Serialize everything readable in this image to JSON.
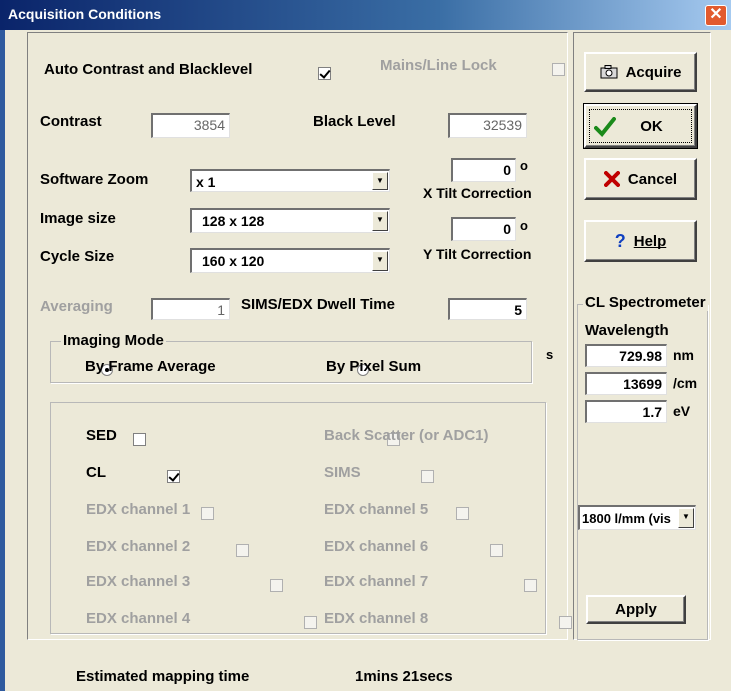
{
  "window": {
    "title": "Acquisition Conditions",
    "close_glyph": "✕"
  },
  "top": {
    "auto_contrast_label": "Auto Contrast and Blacklevel",
    "mains_lock_label": "Mains/Line Lock",
    "contrast_label": "Contrast",
    "contrast_value": "3854",
    "black_level_label": "Black Level",
    "black_level_value": "32539",
    "software_zoom_label": "Software Zoom",
    "software_zoom_value": "x 1",
    "image_size_label": "Image size",
    "image_size_value": "128  x  128",
    "cycle_size_label": "Cycle Size",
    "cycle_size_value": "160  x 120",
    "x_tilt_value": "0",
    "x_tilt_unit": "o",
    "x_tilt_label": "X Tilt Correction",
    "y_tilt_value": "0",
    "y_tilt_unit": "o",
    "y_tilt_label": "Y Tilt Correction",
    "averaging_label": "Averaging",
    "averaging_value": "1",
    "dwell_label": "SIMS/EDX Dwell Time",
    "dwell_value": "5",
    "clipped_text": "s"
  },
  "imaging_mode": {
    "legend": "Imaging Mode",
    "frame_average": "By Frame Average",
    "pixel_sum": "By Pixel Sum"
  },
  "channels": {
    "sed": "SED",
    "cl": "CL",
    "back_scatter": "Back Scatter (or ADC1)",
    "sims": "SIMS",
    "edx1": "EDX channel 1",
    "edx2": "EDX channel 2",
    "edx3": "EDX channel 3",
    "edx4": "EDX channel 4",
    "edx5": "EDX channel 5",
    "edx6": "EDX channel 6",
    "edx7": "EDX channel 7",
    "edx8": "EDX channel 8"
  },
  "buttons": {
    "acquire": "Acquire",
    "ok": "OK",
    "cancel": "Cancel",
    "help": "Help",
    "apply": "Apply"
  },
  "spectrometer": {
    "legend": "CL Spectrometer",
    "wavelength_label": "Wavelength",
    "nm_value": "729.98",
    "nm_unit": "nm",
    "cm_value": "13699",
    "cm_unit": "/cm",
    "ev_value": "1.7",
    "ev_unit": "eV",
    "grating_value": "1800 l/mm (vis"
  },
  "footer": {
    "estimated_label": "Estimated mapping time",
    "estimated_value": "1mins 21secs"
  },
  "colors": {
    "title_bar": "#0a246a",
    "dialog_bg": "#ece9d8",
    "ok_check": "#1a8a1a",
    "cancel_x": "#c00000",
    "help_q": "#1040c0"
  }
}
